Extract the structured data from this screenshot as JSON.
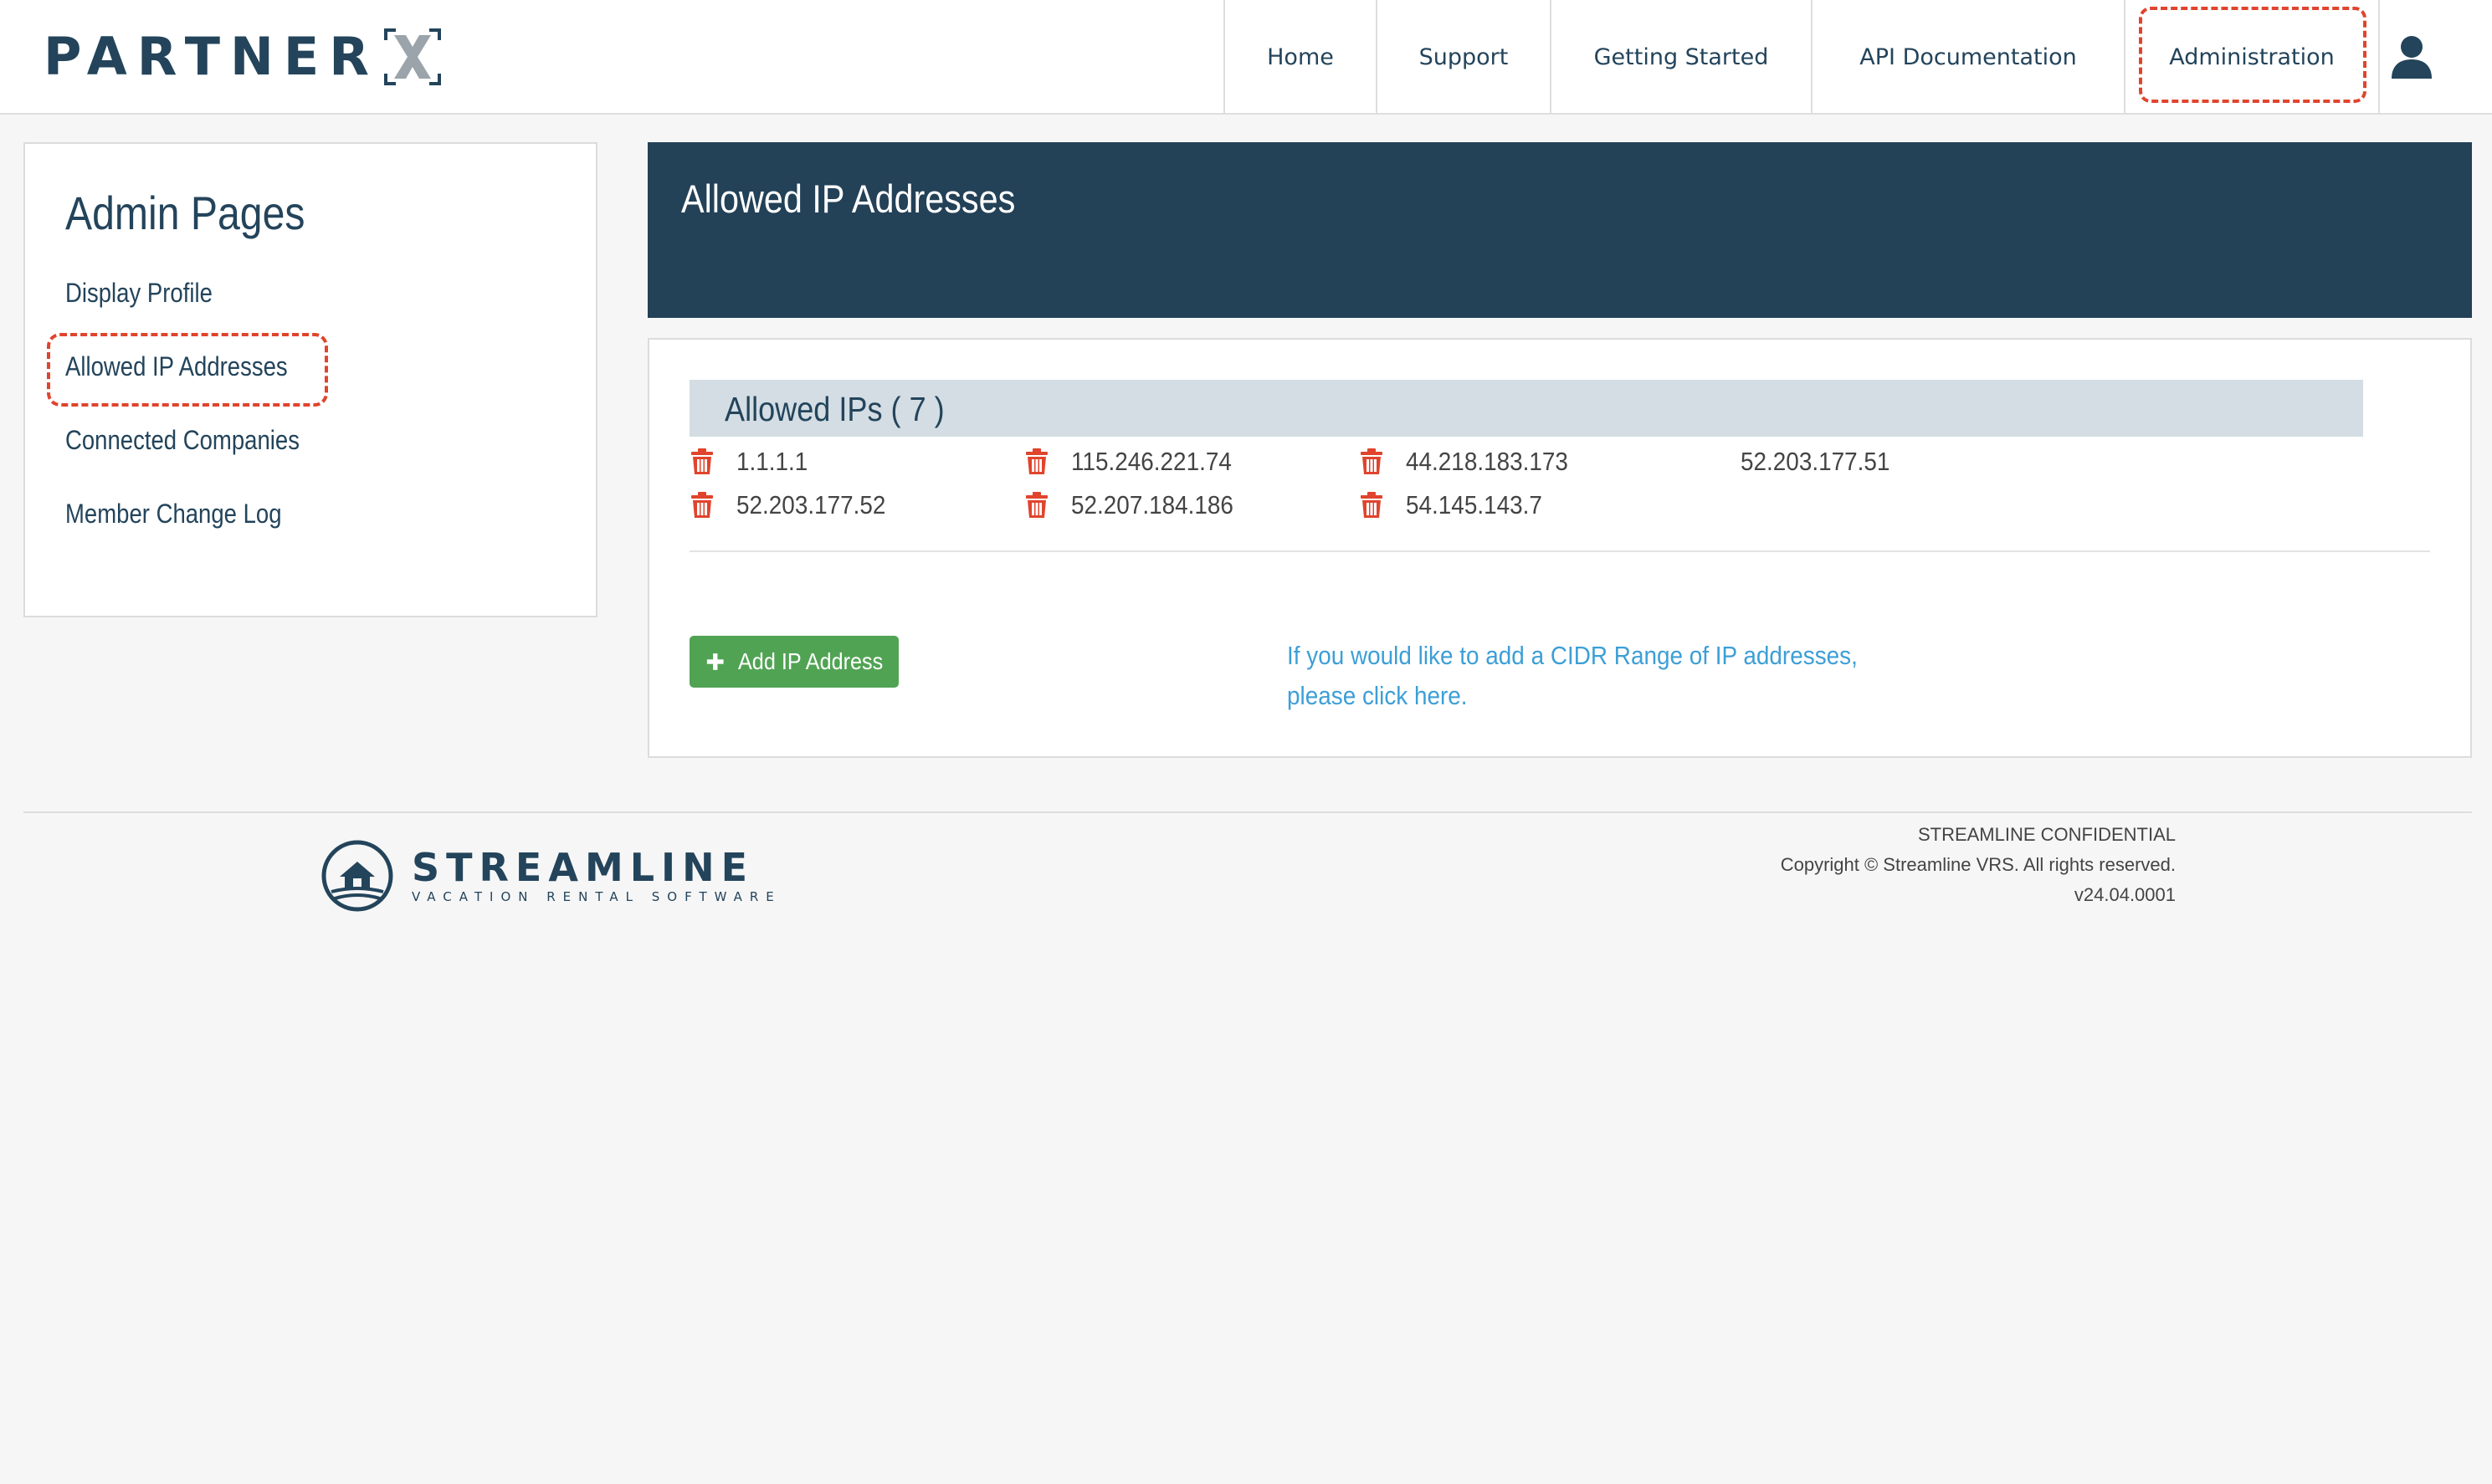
{
  "brand": {
    "name": "PARTNER",
    "mark": "X"
  },
  "nav": {
    "items": [
      {
        "label": "Home"
      },
      {
        "label": "Support"
      },
      {
        "label": "Getting Started"
      },
      {
        "label": "API Documentation"
      },
      {
        "label": "Administration"
      }
    ],
    "active": "Administration"
  },
  "sidebar": {
    "title": "Admin Pages",
    "items": [
      {
        "label": "Display Profile"
      },
      {
        "label": "Allowed IP Addresses"
      },
      {
        "label": "Connected Companies"
      },
      {
        "label": "Member Change Log"
      }
    ]
  },
  "main": {
    "title": "Allowed IP Addresses",
    "ips_header": "Allowed IPs ( 7 )",
    "ips": [
      {
        "address": "1.1.1.1",
        "deletable": true
      },
      {
        "address": "115.246.221.74",
        "deletable": true
      },
      {
        "address": "44.218.183.173",
        "deletable": true
      },
      {
        "address": "52.203.177.51",
        "deletable": false
      },
      {
        "address": "52.203.177.52",
        "deletable": true
      },
      {
        "address": "52.207.184.186",
        "deletable": true
      },
      {
        "address": "54.145.143.7",
        "deletable": true
      }
    ],
    "add_button": "Add IP Address",
    "cidr_line1": "If you would like to add a CIDR Range of IP addresses,",
    "cidr_line2": "please click here."
  },
  "footer": {
    "logo_name": "STREAMLINE",
    "logo_sub": "VACATION RENTAL SOFTWARE",
    "confidential": "STREAMLINE CONFIDENTIAL",
    "copyright": "Copyright © Streamline VRS. All rights reserved.",
    "version": "v24.04.0001"
  },
  "colors": {
    "navy": "#23445b",
    "banner": "#234157",
    "accent_red": "#e0442d",
    "green": "#51a354",
    "link_blue": "#3d9fd6",
    "ip_header_bg": "#d3dde3"
  },
  "icons": {
    "user": "user-icon",
    "delete": "trash-icon",
    "add": "plus-icon"
  }
}
